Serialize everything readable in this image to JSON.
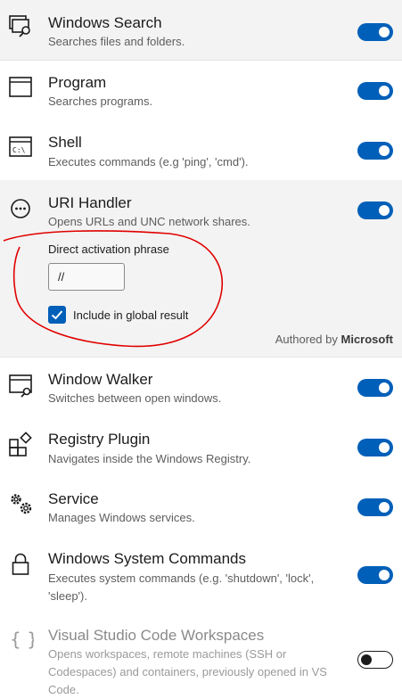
{
  "plugins": [
    {
      "title": "Windows Search",
      "description": "Searches files and folders.",
      "icon": "windows-search-icon",
      "enabled": true
    },
    {
      "title": "Program",
      "description": "Searches programs.",
      "icon": "program-window-icon",
      "enabled": true
    },
    {
      "title": "Shell",
      "description": "Executes commands (e.g 'ping', 'cmd').",
      "icon": "shell-terminal-icon",
      "enabled": true
    },
    {
      "title": "URI Handler",
      "description": "Opens URLs and UNC network shares.",
      "icon": "uri-handler-icon",
      "enabled": true
    },
    {
      "title": "Window Walker",
      "description": "Switches between open windows.",
      "icon": "window-walker-icon",
      "enabled": true
    },
    {
      "title": "Registry Plugin",
      "description": "Navigates inside the Windows Registry.",
      "icon": "registry-icon",
      "enabled": true
    },
    {
      "title": "Service",
      "description": "Manages Windows services.",
      "icon": "service-gears-icon",
      "enabled": true
    },
    {
      "title": "Windows System Commands",
      "description_lines": [
        "Executes system commands (e.g. 'shutdown', 'lock',",
        "'sleep')."
      ],
      "icon": "lock-icon",
      "enabled": true
    },
    {
      "title": "Visual Studio Code Workspaces",
      "description_lines": [
        "Opens workspaces, remote machines (SSH or",
        "Codespaces) and containers, previously opened in VS",
        "Code."
      ],
      "icon": "braces-icon",
      "enabled": false
    }
  ],
  "expanded": {
    "activation_label": "Direct activation phrase",
    "activation_value": "//",
    "include_global_label": "Include in global result",
    "include_global_checked": true,
    "authored_by_prefix": "Authored by",
    "author": "Microsoft"
  },
  "colors": {
    "accent": "#005fb8",
    "annotation": "#e00000"
  }
}
